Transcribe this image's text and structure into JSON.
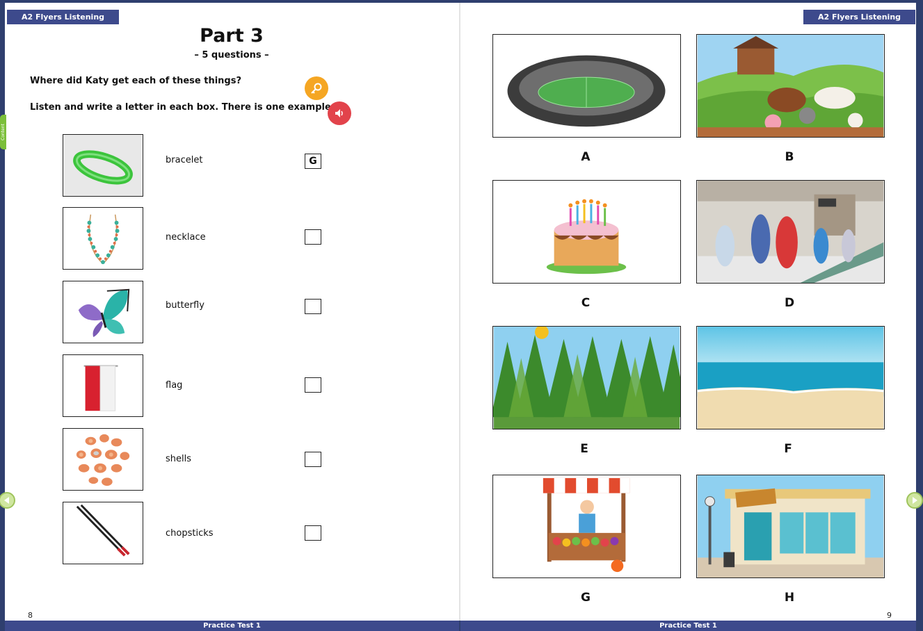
{
  "header": {
    "left_label": "A2 Flyers Listening",
    "right_label": "A2 Flyers Listening"
  },
  "side_tab": {
    "label": "Content"
  },
  "part": {
    "title": "Part 3",
    "subtitle": "– 5 questions –"
  },
  "instructions": {
    "question": "Where did Katy get each of these things?",
    "task": "Listen and write a letter in each box. There is one example."
  },
  "buttons": {
    "key_icon": "key-icon",
    "audio_icon": "speaker-icon"
  },
  "items": [
    {
      "label": "bracelet",
      "answer": "G",
      "icon": "bracelet-image"
    },
    {
      "label": "necklace",
      "answer": "",
      "icon": "necklace-image"
    },
    {
      "label": "butterfly",
      "answer": "",
      "icon": "butterfly-image"
    },
    {
      "label": "flag",
      "answer": "",
      "icon": "flag-image"
    },
    {
      "label": "shells",
      "answer": "",
      "icon": "shells-image"
    },
    {
      "label": "chopsticks",
      "answer": "",
      "icon": "chopsticks-image"
    }
  ],
  "pictures": [
    {
      "letter": "A",
      "icon": "stadium-image"
    },
    {
      "letter": "B",
      "icon": "farm-image"
    },
    {
      "letter": "C",
      "icon": "birthday-cake-image"
    },
    {
      "letter": "D",
      "icon": "shopping-mall-image"
    },
    {
      "letter": "E",
      "icon": "forest-image"
    },
    {
      "letter": "F",
      "icon": "beach-image"
    },
    {
      "letter": "G",
      "icon": "market-stall-image"
    },
    {
      "letter": "H",
      "icon": "restaurant-image"
    }
  ],
  "footer": {
    "left_label": "Practice Test 1",
    "right_label": "Practice Test 1",
    "left_page": "8",
    "right_page": "9"
  },
  "colors": {
    "header_bg": "#3d4a8c",
    "key_button": "#f5a623",
    "audio_button": "#e2434b",
    "nav_arrow": "#9fc45c"
  }
}
